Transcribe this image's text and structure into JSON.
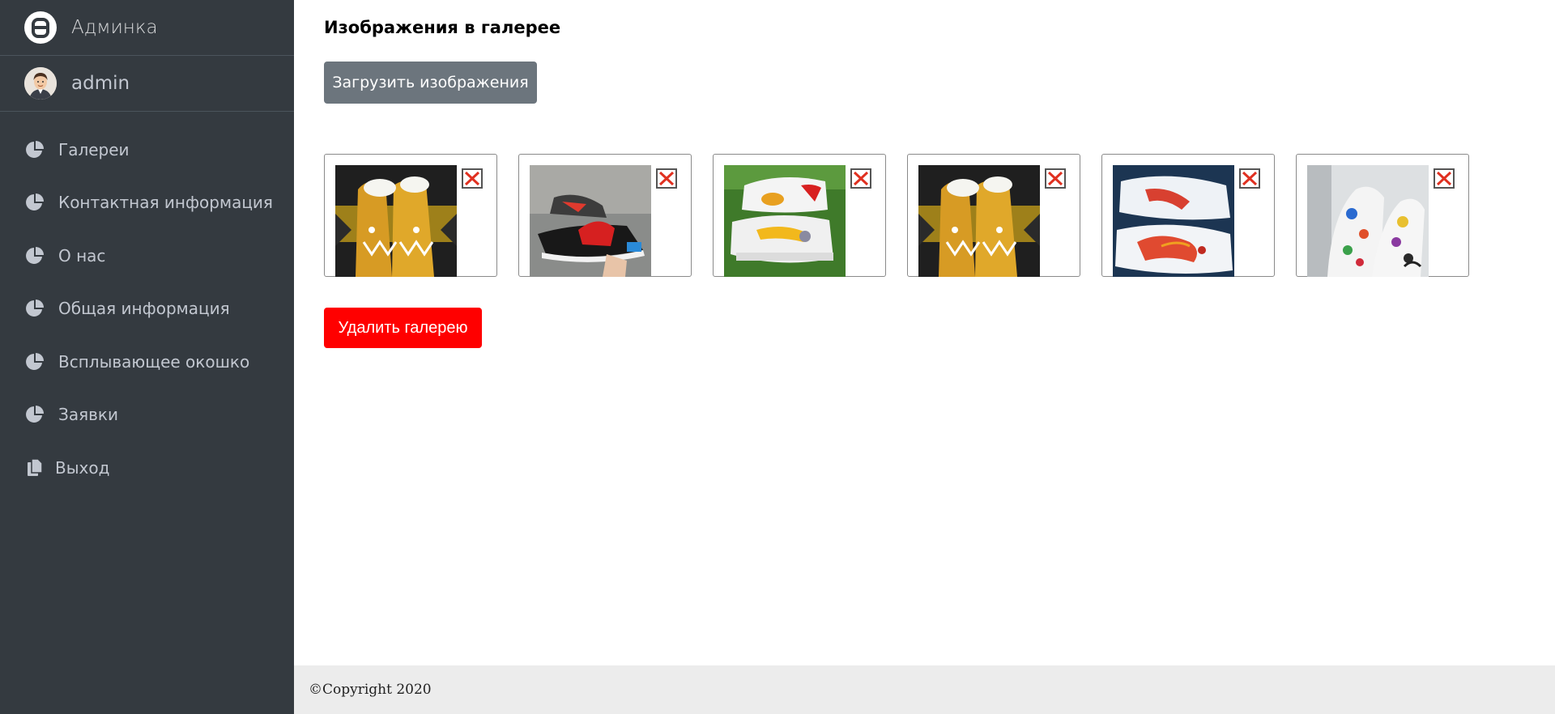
{
  "brand": {
    "name": "Админка",
    "logo_icon": "admin-logo-icon"
  },
  "user": {
    "name": "admin",
    "avatar_icon": "user-avatar"
  },
  "sidebar": {
    "items": [
      {
        "label": "Галереи",
        "icon": "pie-chart-icon"
      },
      {
        "label": "Контактная информация",
        "icon": "pie-chart-icon"
      },
      {
        "label": "О нас",
        "icon": "pie-chart-icon"
      },
      {
        "label": "Общая информация",
        "icon": "pie-chart-icon"
      },
      {
        "label": "Всплывающее окошко",
        "icon": "pie-chart-icon"
      },
      {
        "label": "Заявки",
        "icon": "pie-chart-icon"
      },
      {
        "label": "Выход",
        "icon": "copy-icon"
      }
    ]
  },
  "main": {
    "title": "Изображения в галерее",
    "upload_label": "Загрузить изображения",
    "delete_gallery_label": "Удалить галерею",
    "images": [
      {
        "name": "sneaker-yellow-shark",
        "delete_icon": "delete-x-icon"
      },
      {
        "name": "sneaker-black-red",
        "delete_icon": "delete-x-icon"
      },
      {
        "name": "sneaker-tom-jerry",
        "delete_icon": "delete-x-icon"
      },
      {
        "name": "sneaker-yellow-shark",
        "delete_icon": "delete-x-icon"
      },
      {
        "name": "sneaker-red-dragon",
        "delete_icon": "delete-x-icon"
      },
      {
        "name": "sneaker-stickers",
        "delete_icon": "delete-x-icon"
      }
    ]
  },
  "footer": {
    "text": "©Copyright 2020"
  },
  "colors": {
    "sidebar_bg": "#343a40",
    "upload_button": "#6c757d",
    "delete_button": "#ff0000",
    "footer_bg": "#ececec"
  }
}
